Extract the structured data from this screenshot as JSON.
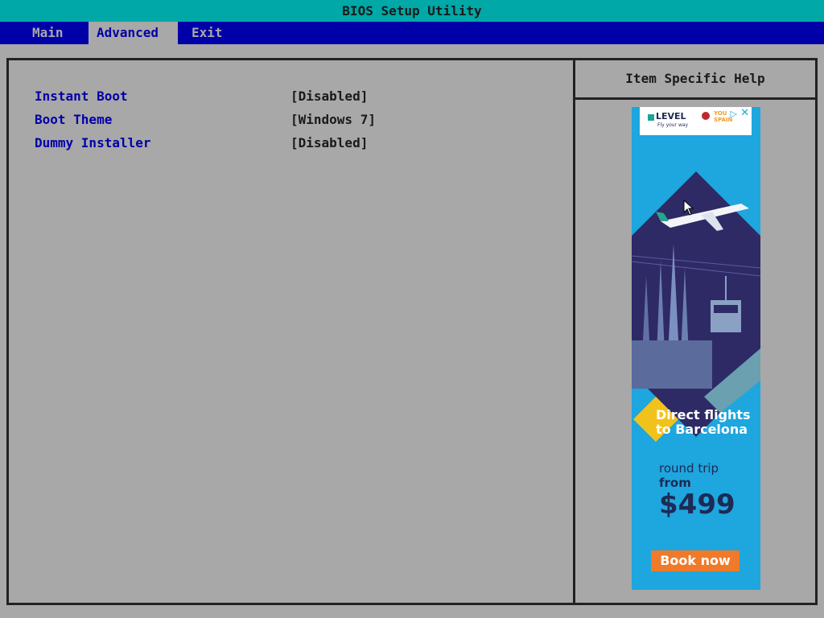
{
  "window": {
    "title": "BIOS Setup Utility"
  },
  "tabs": [
    {
      "label": "Main"
    },
    {
      "label": "Advanced"
    },
    {
      "label": "Exit"
    }
  ],
  "options": [
    {
      "label": "Instant Boot",
      "value": "[Disabled]"
    },
    {
      "label": "Boot Theme",
      "value": "[Windows 7]"
    },
    {
      "label": "Dummy Installer",
      "value": "[Disabled]"
    }
  ],
  "help": {
    "title": "Item Specific Help"
  },
  "ad": {
    "brand": "LEVEL",
    "brand_tagline": "Fly your way",
    "partner_line1": "YOU",
    "partner_line2": "SPAIN",
    "headline_line1": "Direct flights",
    "headline_line2": "to Barcelona",
    "round_trip": "round trip",
    "from": "from",
    "price": "$499",
    "cta": "Book now"
  },
  "colors": {
    "title_bar": "#00a8a8",
    "menu_bar": "#0000a8",
    "background": "#a8a8a8",
    "ad_background": "#1ea6de",
    "cta": "#ef7a2a"
  }
}
